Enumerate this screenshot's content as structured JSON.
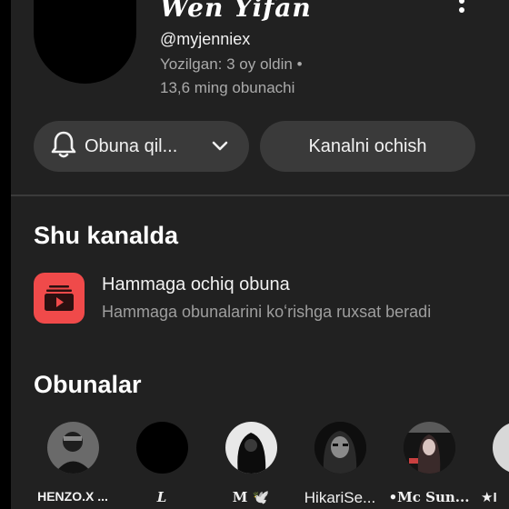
{
  "channel": {
    "name": "Wen Yifan",
    "handle": "@myjenniex",
    "joined": "Yozilgan: 3 oy oldin •",
    "subscribers": "13,6 ming obunachi"
  },
  "actions": {
    "subscribe_label": "Obuna qil...",
    "open_channel_label": "Kanalni ochish"
  },
  "section_on_channel": {
    "title": "Shu kanalda",
    "feature_title": "Hammaga ochiq obuna",
    "feature_desc": "Hammaga obunalarini koʻrishga ruxsat beradi"
  },
  "subscriptions": {
    "title": "Obunalar",
    "items": [
      {
        "label": "HENZO.X ..."
      },
      {
        "label": "L"
      },
      {
        "label": "M 🕊️"
      },
      {
        "label": "HikariSe..."
      },
      {
        "label": "•Mc Sun..."
      },
      {
        "label": "★I"
      }
    ]
  },
  "icons": {
    "menu": "more-vert-icon",
    "bell": "bell-icon",
    "chevron": "chevron-down-icon",
    "feature": "subscriptions-icon"
  },
  "colors": {
    "panel_bg": "#212121",
    "button_bg": "#3a3a3a",
    "feature_icon_bg": "#f04a4a",
    "secondary_text": "#aaaaaa"
  }
}
